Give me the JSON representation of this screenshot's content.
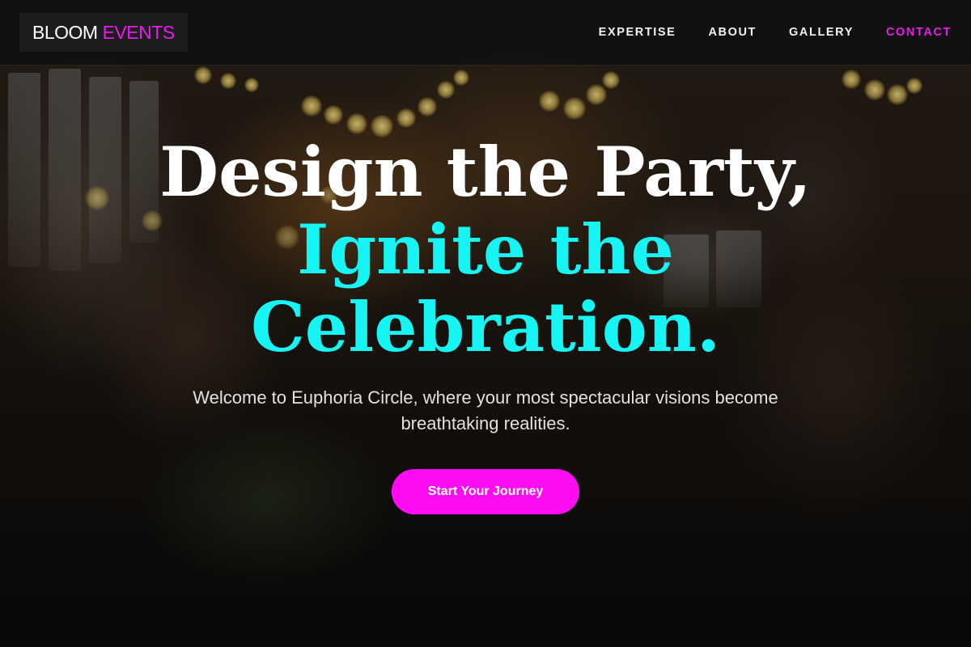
{
  "header": {
    "logo": {
      "word1": "BLOOM",
      "word2": "EVENTS"
    },
    "nav": [
      {
        "label": "EXPERTISE"
      },
      {
        "label": "ABOUT"
      },
      {
        "label": "GALLERY"
      },
      {
        "label": "CONTACT",
        "active": true
      }
    ]
  },
  "hero": {
    "headline": {
      "line1": "Design the Party,",
      "line2": "Ignite the",
      "line3": "Celebration."
    },
    "subtitle": "Welcome to Euphoria Circle, where your most spectacular visions become breathtaking realities.",
    "cta_label": "Start Your Journey"
  },
  "colors": {
    "accent_magenta": "#e81cf0",
    "accent_cyan": "#16f4f4",
    "button": "#ff0cf5",
    "header_bg": "#101010"
  }
}
